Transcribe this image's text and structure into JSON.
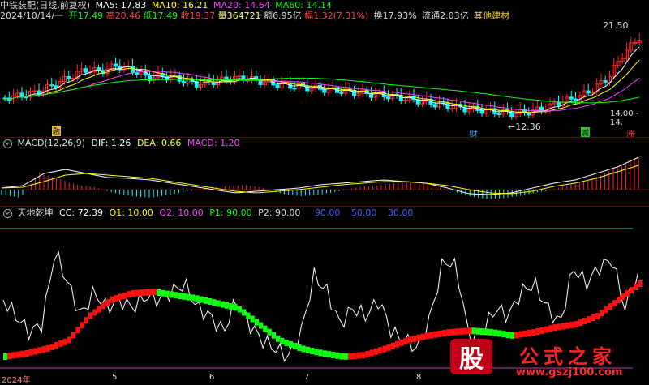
{
  "header": {
    "title": "中铁装配(日线,前复权)",
    "ma5": "MA5: 17.83",
    "ma10": "MA10: 16.21",
    "ma20": "MA20: 14.64",
    "ma60": "MA60: 14.14",
    "date": "2024/10/14/一",
    "open": "开17.49",
    "high": "高20.46",
    "low": "低17.49",
    "close": "收19.37",
    "volume": "量364721",
    "amount": "额6.95亿",
    "change": "幅1.32(7.31%)",
    "turnover": "换17.93%",
    "float_cap": "流通2.03亿",
    "sector": "其他建材"
  },
  "price_panel": {
    "high_label": "21.50",
    "low_label": "←12.36",
    "right_label": "14.00 - 14.",
    "markers": {
      "m1": "融",
      "m2": "财",
      "m3": "减",
      "m4": "涨"
    }
  },
  "macd_panel": {
    "title": "MACD(12,26,9)",
    "dif": "DIF: 1.26",
    "dea": "DEA: 0.66",
    "macd": "MACD: 1.20"
  },
  "indicator_panel": {
    "title": "天地乾坤",
    "cc": "CC: 72.39",
    "q1": "Q1: 10.00",
    "q2": "Q2: 10.00",
    "p1": "P1: 90.00",
    "p2": "P2: 90.00",
    "v1": "90.00",
    "v2": "50.00",
    "v3": "30.00"
  },
  "time_axis": {
    "year": "2024年",
    "m5": "5",
    "m6": "6",
    "m7": "7",
    "m8": "8"
  },
  "watermark": {
    "logo": "股",
    "text": "公式之家",
    "url": "www.gszj100.com"
  },
  "colors": {
    "ma5": "#ffffff",
    "ma10": "#ffff00",
    "ma20": "#ff40ff",
    "ma60": "#00ff00",
    "up": "#ff2020",
    "down": "#00ffff",
    "band_red": "#ff1010",
    "band_green": "#10ff10"
  }
}
